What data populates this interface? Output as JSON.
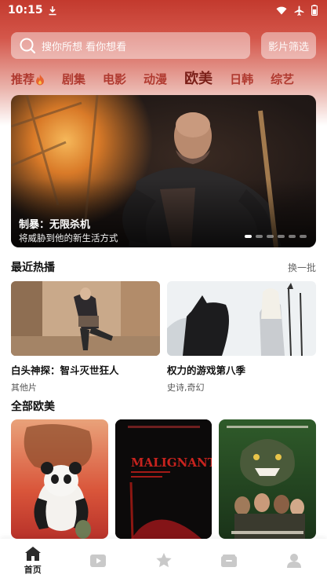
{
  "status_bar": {
    "time": "10:15"
  },
  "search": {
    "placeholder": "搜你所想 看你想看",
    "filter_label": "影片筛选"
  },
  "category_tabs": [
    {
      "label": "推荐",
      "has_fire": true
    },
    {
      "label": "剧集"
    },
    {
      "label": "电影"
    },
    {
      "label": "动漫"
    },
    {
      "label": "欧美",
      "active": true
    },
    {
      "label": "日韩"
    },
    {
      "label": "综艺"
    }
  ],
  "hero": {
    "title": "制暴：无限杀机",
    "subtitle": "将威胁到他的新生活方式",
    "slide_count": 6,
    "active_index": 0
  },
  "recent_hot": {
    "title": "最近热播",
    "action": "换一批",
    "items": [
      {
        "title": "白头神探：智斗灭世狂人",
        "tags": "其他片"
      },
      {
        "title": "权力的游戏第八季",
        "tags": "史诗,奇幻"
      }
    ]
  },
  "all_western": {
    "title": "全部欧美",
    "posters": [
      {
        "name": "kung-fu-panda-poster"
      },
      {
        "name": "malignant-poster",
        "overlay_text": "MALIGNANT"
      },
      {
        "name": "jumanji-poster"
      }
    ]
  },
  "tab_bar": {
    "items": [
      {
        "label": "首页",
        "icon": "home-icon",
        "active": true
      },
      {
        "label": "",
        "icon": "video-icon"
      },
      {
        "label": "",
        "icon": "star-icon"
      },
      {
        "label": "",
        "icon": "folder-icon"
      },
      {
        "label": "",
        "icon": "user-icon"
      }
    ]
  },
  "colors": {
    "brand": "#c33a2e",
    "active_tab": "#7a1f18",
    "tab_text": "#b03a30"
  }
}
